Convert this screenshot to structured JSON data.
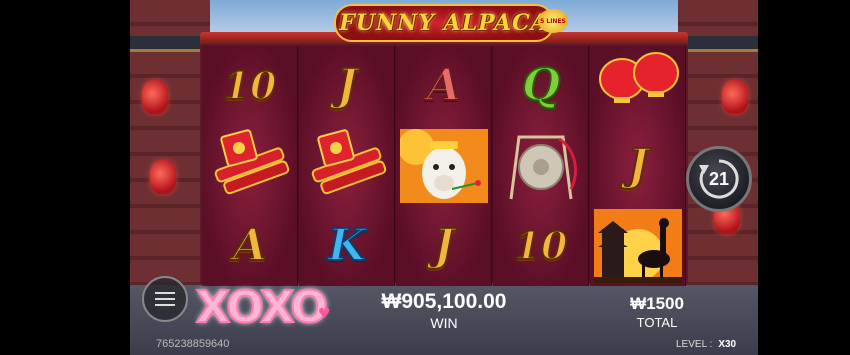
{
  "game": {
    "title": "FUNNY ALPACA",
    "badge": "5 LINES"
  },
  "reels": [
    [
      {
        "symbol": "10",
        "kind": "text",
        "color": "gold",
        "name": "symbol-ten"
      },
      {
        "symbol": "firecrackers",
        "kind": "pic",
        "name": "firecrackers-symbol"
      },
      {
        "symbol": "A",
        "kind": "text",
        "color": "gold",
        "name": "symbol-ace"
      }
    ],
    [
      {
        "symbol": "J",
        "kind": "text",
        "color": "gold",
        "name": "symbol-jack"
      },
      {
        "symbol": "firecrackers",
        "kind": "pic",
        "name": "firecrackers-symbol"
      },
      {
        "symbol": "K",
        "kind": "text",
        "color": "blue",
        "name": "symbol-king"
      }
    ],
    [
      {
        "symbol": "A",
        "kind": "text",
        "color": "pinkred",
        "name": "symbol-ace"
      },
      {
        "symbol": "alpaca",
        "kind": "pic",
        "name": "alpaca-wild-symbol"
      },
      {
        "symbol": "J",
        "kind": "text",
        "color": "gold",
        "name": "symbol-jack"
      }
    ],
    [
      {
        "symbol": "Q",
        "kind": "text",
        "color": "green",
        "name": "symbol-queen"
      },
      {
        "symbol": "gong",
        "kind": "pic",
        "name": "gong-symbol"
      },
      {
        "symbol": "10",
        "kind": "text",
        "color": "gold",
        "name": "symbol-ten"
      }
    ],
    [
      {
        "symbol": "lanterns",
        "kind": "pic",
        "name": "lanterns-symbol"
      },
      {
        "symbol": "J",
        "kind": "text",
        "color": "gold",
        "name": "symbol-jack"
      },
      {
        "symbol": "pagoda-alpaca",
        "kind": "pic",
        "name": "pagoda-scatter-symbol"
      }
    ]
  ],
  "spin": {
    "count": "21"
  },
  "player": {
    "sticker": "XOXO",
    "account_id": "765238859640"
  },
  "win": {
    "amount": "₩905,100.00",
    "label": "WIN"
  },
  "total": {
    "amount": "₩1500",
    "label": "TOTAL"
  },
  "level": {
    "label": "LEVEL :",
    "value": "X30"
  }
}
